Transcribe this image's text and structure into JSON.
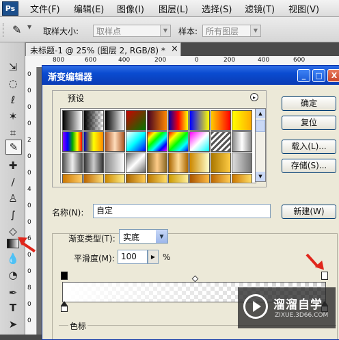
{
  "app": {
    "logo": "Ps"
  },
  "menu": [
    "文件(F)",
    "编辑(E)",
    "图像(I)",
    "图层(L)",
    "选择(S)",
    "滤镜(T)",
    "视图(V)"
  ],
  "options": {
    "sample_size_label": "取样大小:",
    "sample_size_value": "取样点",
    "sample_label": "样本:",
    "sample_value": "所有图层"
  },
  "document": {
    "tab_title": "未标题-1 @ 25% (图层 2, RGB/8) *",
    "close": "×",
    "ruler_ticks": [
      "800",
      "600",
      "400",
      "200",
      "0",
      "200",
      "400",
      "600"
    ],
    "left_ruler_ticks": [
      "0",
      "0",
      "0",
      "0",
      "2",
      "0",
      "0",
      "4",
      "0",
      "0",
      "6",
      "0",
      "0",
      "8",
      "0",
      "0"
    ]
  },
  "dialog": {
    "title": "渐变编辑器",
    "title_buttons": [
      "_",
      "□",
      "X"
    ],
    "presets_label": "预设",
    "presets_menu_icon": "▸",
    "name_label": "名称(N):",
    "name_value": "自定",
    "gradient_type_label": "渐变类型(T):",
    "gradient_type_value": "实底",
    "smoothness_label": "平滑度(M):",
    "smoothness_value": "100",
    "smoothness_unit": "%",
    "color_stops_label": "色标",
    "buttons": {
      "ok": "确定",
      "reset": "复位",
      "load": "载入(L)...",
      "save": "存储(S)...",
      "new": "新建(W)"
    }
  },
  "watermark": {
    "title": "溜溜自学",
    "url": "ZIXUE.3D66.COM"
  },
  "colors": {
    "title_bar": "#0a4bd0",
    "annotation_arrow": "#e0261b",
    "dialog_bg": "#ece9d8"
  }
}
